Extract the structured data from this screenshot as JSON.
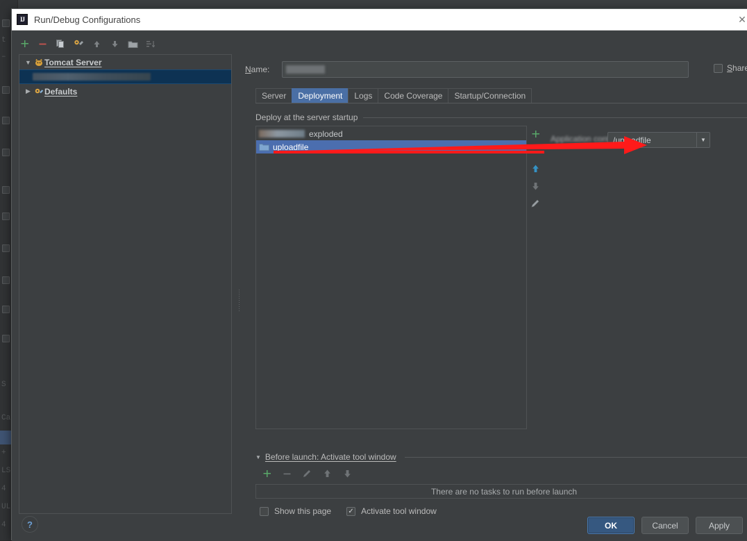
{
  "window": {
    "title": "Run/Debug Configurations",
    "app_icon": "IJ",
    "close_icon": "close-icon"
  },
  "left_pane": {
    "toolbar": [
      {
        "name": "add-configuration-button",
        "icon": "plus-icon",
        "label": "+",
        "color": "#59a869",
        "enabled": true
      },
      {
        "name": "remove-configuration-button",
        "icon": "minus-icon",
        "label": "–",
        "color": "#c75450",
        "enabled": true
      },
      {
        "name": "copy-configuration-button",
        "icon": "copy-icon",
        "label": "",
        "color": "#a0a4a7",
        "enabled": true
      },
      {
        "name": "save-configuration-button",
        "icon": "wrench-gear-icon",
        "label": "",
        "color": "#d9a343",
        "enabled": true
      },
      {
        "name": "move-up-button",
        "icon": "arrow-up-icon",
        "label": "↑",
        "color": "#808486",
        "enabled": false
      },
      {
        "name": "move-down-button",
        "icon": "arrow-down-icon",
        "label": "↓",
        "color": "#808486",
        "enabled": false
      },
      {
        "name": "new-folder-button",
        "icon": "folder-icon",
        "label": "",
        "color": "#8a8d8f",
        "enabled": true
      },
      {
        "name": "sort-configurations-button",
        "icon": "sort-icon",
        "label": "",
        "color": "#6e7173",
        "enabled": false
      }
    ],
    "tree": [
      {
        "label": "Tomcat Server",
        "icon": "tomcat-cat-icon",
        "arrow": "▼",
        "expanded": true,
        "selected": false,
        "redacted": false
      },
      {
        "label": "",
        "icon": "",
        "arrow": "",
        "expanded": false,
        "selected": true,
        "redacted": true
      },
      {
        "label": "Defaults",
        "icon": "defaults-gear-icon",
        "arrow": "▶",
        "expanded": false,
        "selected": false,
        "redacted": false
      }
    ],
    "help_button": {
      "name": "help-button",
      "label": "?"
    }
  },
  "right_pane": {
    "name_field": {
      "label": "Name:",
      "label_mnemonic": "N",
      "value": "",
      "redacted": true
    },
    "share_checkbox": {
      "label": "Share",
      "label_mnemonic": "S",
      "checked": false
    },
    "tabs": [
      {
        "label": "Server",
        "active": false
      },
      {
        "label": "Deployment",
        "active": true
      },
      {
        "label": "Logs",
        "active": false
      },
      {
        "label": "Code Coverage",
        "active": false
      },
      {
        "label": "Startup/Connection",
        "active": false
      }
    ],
    "deployment": {
      "caption": "Deploy at the server startup",
      "artifacts": [
        {
          "label": "exploded",
          "icon": "artifact-icon",
          "selected": false,
          "redacted_prefix": true
        },
        {
          "label": "uploadfile",
          "icon": "folder-icon",
          "selected": true,
          "redacted_prefix": false
        }
      ],
      "side_toolbar": [
        {
          "name": "add-artifact-button",
          "icon": "plus-icon",
          "label": "+",
          "color": "#59a869",
          "enabled": true
        },
        {
          "name": "remove-artifact-button",
          "icon": "minus-icon",
          "label": "–",
          "color": "#c75450",
          "enabled": true
        },
        {
          "name": "move-artifact-up-button",
          "icon": "arrow-up-icon",
          "label": "↑",
          "color": "#3592c4",
          "enabled": true
        },
        {
          "name": "move-artifact-down-button",
          "icon": "arrow-down-icon",
          "label": "↓",
          "color": "#6f7376",
          "enabled": false
        },
        {
          "name": "edit-artifact-button",
          "icon": "pencil-icon",
          "label": "✎",
          "color": "#8a8d8f",
          "enabled": true
        }
      ],
      "application_context": {
        "label": "Application context:",
        "value": "/uploadfile",
        "dropdown_arrow": "▼"
      }
    },
    "before_launch": {
      "caption": "Before launch: Activate tool window",
      "caption_mnemonic": "B",
      "triangle": "▼",
      "toolbar": [
        {
          "name": "add-task-button",
          "icon": "plus-icon",
          "label": "+",
          "color": "#59a869",
          "enabled": true
        },
        {
          "name": "remove-task-button",
          "icon": "minus-icon",
          "label": "–",
          "color": "#6f7376",
          "enabled": false
        },
        {
          "name": "edit-task-button",
          "icon": "pencil-icon",
          "label": "✎",
          "color": "#6f7376",
          "enabled": false
        },
        {
          "name": "task-move-up-button",
          "icon": "arrow-up-icon",
          "label": "↑",
          "color": "#6f7376",
          "enabled": false
        },
        {
          "name": "task-move-down-button",
          "icon": "arrow-down-icon",
          "label": "↓",
          "color": "#6f7376",
          "enabled": false
        }
      ],
      "empty_text": "There are no tasks to run before launch",
      "show_page_checkbox": {
        "label": "Show this page",
        "checked": false
      },
      "activate_tool_window_checkbox": {
        "label": "Activate tool window",
        "checked": true
      }
    }
  },
  "buttons": {
    "ok": "OK",
    "cancel": "Cancel",
    "apply": "Apply"
  },
  "annotation": {
    "arrow_color": "#ff1a1a",
    "description": "red arrow pointing to application context field"
  },
  "colors": {
    "dialog_bg": "#3c3f41",
    "titlebar_bg": "#ffffff",
    "selection_blue": "#4b6eaf",
    "tree_selection": "#0d3253",
    "accent_green": "#59a869",
    "accent_red": "#c75450",
    "primary_button": "#365880"
  },
  "background_ide": {
    "ghost_lines": [
      "<",
      "t",
      "–",
      "<",
      "S",
      "Ca",
      "+ ,",
      "LS",
      "4 ,",
      "UL",
      "4 ,"
    ]
  }
}
